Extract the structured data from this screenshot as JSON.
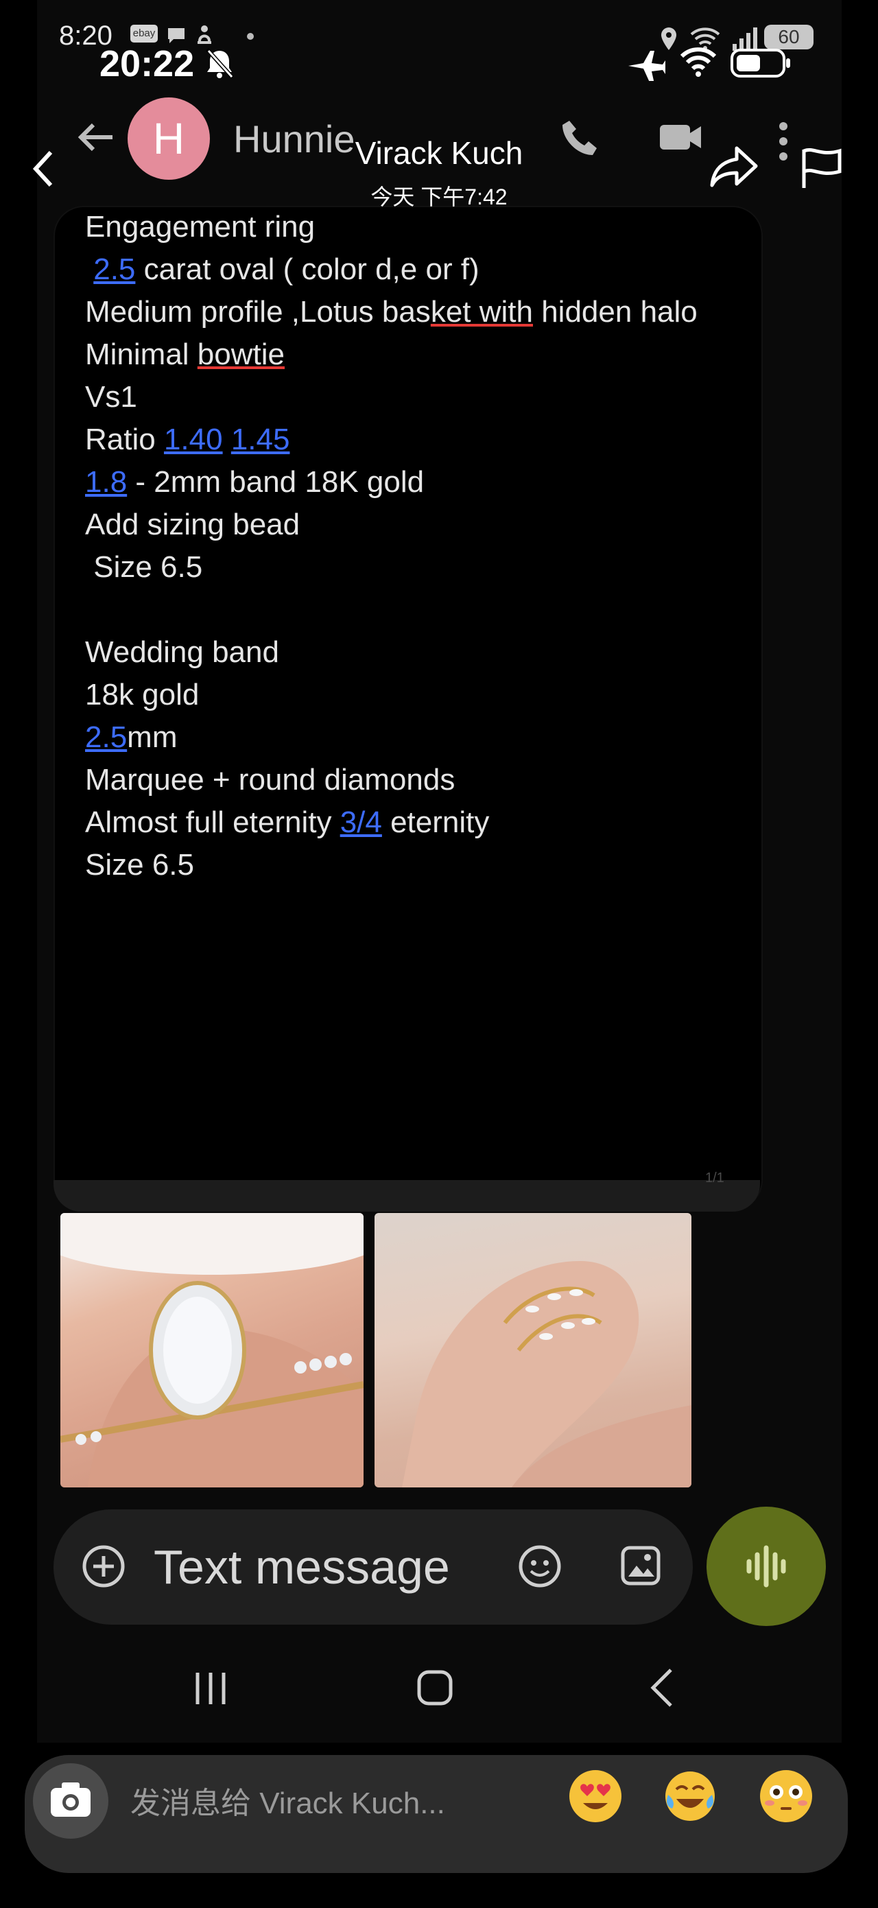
{
  "inner_status": {
    "time": "8:20",
    "ebay_badge": "ebay",
    "battery": "60"
  },
  "inner_chat": {
    "avatar_letter": "H",
    "contact_name": "Hunnie",
    "message_lines": [
      [
        "Engagement ring"
      ],
      [
        " ",
        {
          "link": "2.5"
        },
        " carat oval ( color d,e or f)"
      ],
      [
        "Medium profile ,Lotus bas",
        {
          "red": "ket with"
        },
        " hidden halo"
      ],
      [
        "Minimal ",
        {
          "red": "bowtie"
        }
      ],
      [
        "Vs1"
      ],
      [
        "Ratio ",
        {
          "link": "1.40"
        },
        " ",
        {
          "link": "1.45"
        }
      ],
      [
        {
          "link": "1.8"
        },
        " - 2mm band 18K gold"
      ],
      [
        "Add sizing bead"
      ],
      [
        " Size 6.5"
      ],
      [
        ""
      ],
      [
        "Wedding band"
      ],
      [
        "18k gold"
      ],
      [
        {
          "link": "2.5"
        },
        "mm"
      ],
      [
        "Marquee + round diamonds"
      ],
      [
        "Almost full eternity ",
        {
          "link": "3/4"
        },
        " eternity"
      ],
      [
        "Size 6.5"
      ]
    ],
    "page_indicator": "1/1",
    "compose_placeholder": "Text message"
  },
  "outer_status": {
    "time": "20:22"
  },
  "overlay_header": {
    "name": "Virack Kuch",
    "timestamp": "今天 下午7:42"
  },
  "reply_bar": {
    "placeholder": "发消息给 Virack Kuch...",
    "reactions": [
      "heart-eyes",
      "tears-of-joy",
      "flushed"
    ]
  },
  "colors": {
    "link": "#3d6cff",
    "accent_green": "#5f6f1a",
    "avatar_pink": "#e48c9b"
  }
}
